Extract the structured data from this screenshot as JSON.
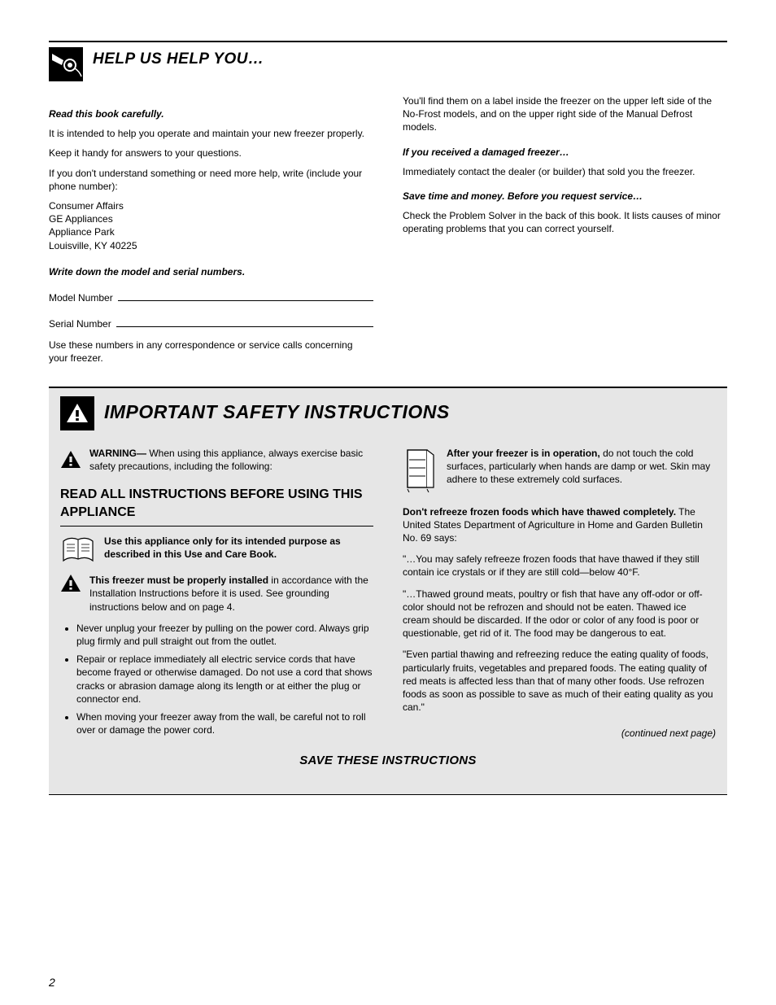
{
  "page_number": "2",
  "header": {
    "title": "HELP US HELP YOU…"
  },
  "intro": {
    "p1": "Read this book carefully.",
    "p2": "It is intended to help you operate and maintain your new freezer properly.",
    "p3": "Keep it handy for answers to your questions.",
    "p4": "If you don't understand something or need more help, write (include your phone number):",
    "addr1": "Consumer Affairs",
    "addr2": "GE Appliances",
    "addr3": "Appliance Park",
    "addr4": "Louisville, KY 40225",
    "write_label": "Write down the model and serial numbers.",
    "field_model": "Model Number",
    "field_serial": "Serial Number",
    "spec_note": "Use these numbers in any correspondence or service calls concerning your freezer."
  },
  "right_col": {
    "damaged_title": "If you received a damaged freezer…",
    "damaged_body": "Immediately contact the dealer (or builder) that sold you the freezer.",
    "money_title": "Save time and money. Before you request service…",
    "money_body": "Check the Problem Solver in the back of this book. It lists causes of minor operating problems that you can correct yourself.",
    "plate_body": "You'll find them on a label inside the freezer on the upper left side of the No-Frost models, and on the upper right side of the Manual Defrost models."
  },
  "safety": {
    "header": "IMPORTANT SAFETY INSTRUCTIONS",
    "read_all": "READ ALL INSTRUCTIONS BEFORE USING THIS APPLIANCE",
    "warning": "WARNING—",
    "warning_body": "When using this appliance, always exercise basic safety precautions, including the following:",
    "left": {
      "use_title": "Use this appliance only for its intended purpose as described in this Use and Care Book.",
      "install_title": "This freezer must be properly installed",
      "install_body": "in accordance with the Installation Instructions before it is used. See grounding instructions below and on page 4.",
      "bullets": [
        "Never unplug your freezer by pulling on the power cord. Always grip plug firmly and pull straight out from the outlet.",
        "Repair or replace immediately all electric service cords that have become frayed or otherwise damaged. Do not use a cord that shows cracks or abrasion damage along its length or at either the plug or connector end.",
        "When moving your freezer away from the wall, be careful not to roll over or damage the power cord."
      ]
    },
    "right": {
      "service_title": "After your freezer is in operation,",
      "service_body": "do not touch the cold surfaces, particularly when hands are damp or wet. Skin may adhere to these extremely cold surfaces.",
      "unplug_title": "Don't refreeze frozen foods which have thawed completely.",
      "unplug_body": "The United States Department of Agriculture in Home and Garden Bulletin No. 69 says:",
      "quote": "\"…You may safely refreeze frozen foods that have thawed if they still contain ice crystals or if they are still cold—below 40°F.",
      "quote2": "\"…Thawed ground meats, poultry or fish that have any off-odor or off-color should not be refrozen and should not be eaten. Thawed ice cream should be discarded. If the odor or color of any food is poor or questionable, get rid of it. The food may be dangerous to eat.",
      "quote3": "\"Even partial thawing and refreezing reduce the eating quality of foods, particularly fruits, vegetables and prepared foods. The eating quality of red meats is affected less than that of many other foods. Use refrozen foods as soon as possible to save as much of their eating quality as you can.\"",
      "continued": "(continued next page)"
    },
    "save": "SAVE THESE INSTRUCTIONS"
  }
}
